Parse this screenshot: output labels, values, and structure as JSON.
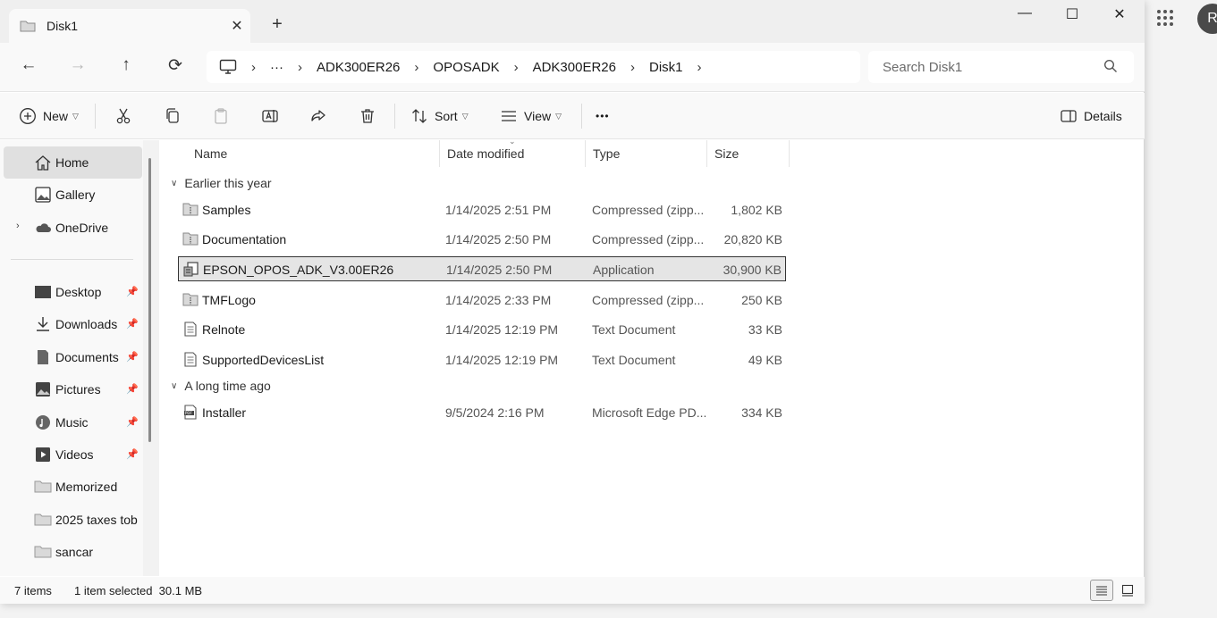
{
  "tab": {
    "title": "Disk1",
    "close": "✕",
    "new_tab": "+"
  },
  "window_controls": {
    "minimize": "—",
    "maximize": "☐",
    "close": "✕"
  },
  "nav": {
    "back": "←",
    "forward": "→",
    "up": "↑",
    "refresh": "⟳"
  },
  "breadcrumb": {
    "overflow": "···",
    "separator": "›",
    "items": [
      "ADK300ER26",
      "OPOSADK",
      "ADK300ER26",
      "Disk1"
    ]
  },
  "search": {
    "placeholder": "Search Disk1"
  },
  "toolbar": {
    "new_label": "New",
    "sort_label": "Sort",
    "view_label": "View",
    "more_label": "•••",
    "details_label": "Details"
  },
  "sidebar": {
    "items": [
      {
        "label": "Home",
        "icon": "home-icon"
      },
      {
        "label": "Gallery",
        "icon": "gallery-icon"
      },
      {
        "label": "OneDrive",
        "icon": "cloud-icon"
      },
      {
        "label": "Desktop",
        "icon": "desktop-icon"
      },
      {
        "label": "Downloads",
        "icon": "download-icon"
      },
      {
        "label": "Documents",
        "icon": "document-icon"
      },
      {
        "label": "Pictures",
        "icon": "pictures-icon"
      },
      {
        "label": "Music",
        "icon": "music-icon"
      },
      {
        "label": "Videos",
        "icon": "videos-icon"
      },
      {
        "label": "Memorized",
        "icon": "folder-icon"
      },
      {
        "label": "2025 taxes tob",
        "icon": "folder-icon"
      },
      {
        "label": "sancar",
        "icon": "folder-icon"
      }
    ]
  },
  "columns": {
    "name": "Name",
    "date": "Date modified",
    "type": "Type",
    "size": "Size"
  },
  "groups": [
    {
      "label": "Earlier this year",
      "files": [
        {
          "name": "Samples",
          "date": "1/14/2025 2:51 PM",
          "type": "Compressed (zipp...",
          "size": "1,802 KB",
          "icon": "zip-folder-icon"
        },
        {
          "name": "Documentation",
          "date": "1/14/2025 2:50 PM",
          "type": "Compressed (zipp...",
          "size": "20,820 KB",
          "icon": "zip-folder-icon"
        },
        {
          "name": "EPSON_OPOS_ADK_V3.00ER26",
          "date": "1/14/2025 2:50 PM",
          "type": "Application",
          "size": "30,900 KB",
          "icon": "installer-icon"
        },
        {
          "name": "TMFLogo",
          "date": "1/14/2025 2:33 PM",
          "type": "Compressed (zipp...",
          "size": "250 KB",
          "icon": "zip-folder-icon"
        },
        {
          "name": "Relnote",
          "date": "1/14/2025 12:19 PM",
          "type": "Text Document",
          "size": "33 KB",
          "icon": "text-file-icon"
        },
        {
          "name": "SupportedDevicesList",
          "date": "1/14/2025 12:19 PM",
          "type": "Text Document",
          "size": "49 KB",
          "icon": "text-file-icon"
        }
      ]
    },
    {
      "label": "A long time ago",
      "files": [
        {
          "name": "Installer",
          "date": "9/5/2024 2:16 PM",
          "type": "Microsoft Edge PD...",
          "size": "334 KB",
          "icon": "pdf-file-icon"
        }
      ]
    }
  ],
  "status": {
    "count": "7 items",
    "selection": "1 item selected  30.1 MB"
  },
  "profile": {
    "initial": "R"
  },
  "colors": {
    "selected_bg": "#e5e5e5",
    "window_bg": "#ffffff",
    "chrome_bg": "#f9f9f9"
  }
}
